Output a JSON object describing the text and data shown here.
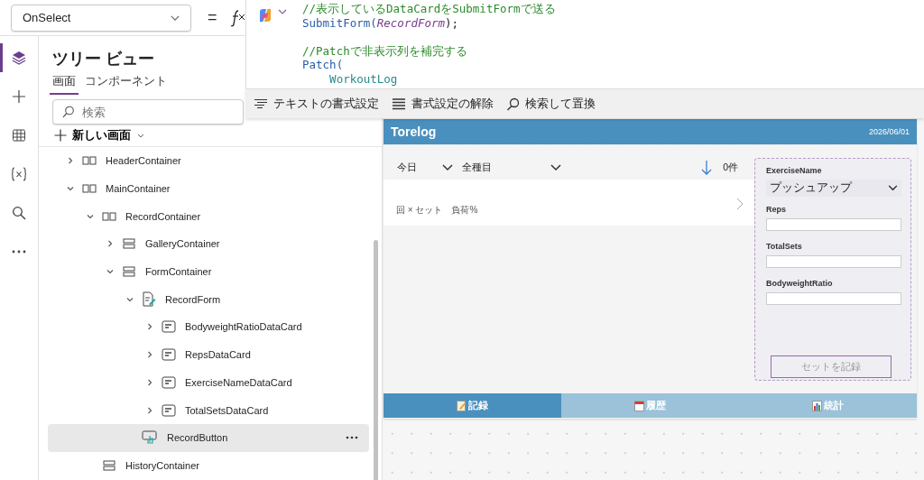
{
  "property_selector": {
    "value": "OnSelect"
  },
  "formula_bar": {
    "equals": "=",
    "lines": [
      [
        {
          "kind": "comment",
          "text": "//表示しているDataCardをSubmitFormで送る"
        }
      ],
      [
        {
          "kind": "function",
          "text": "SubmitForm("
        },
        {
          "kind": "param",
          "text": "RecordForm"
        },
        {
          "kind": "punct",
          "text": ");"
        }
      ],
      [
        {
          "kind": "comment",
          "text": "//Patchで非表示列を補完する"
        }
      ],
      [
        {
          "kind": "function",
          "text": "Patch("
        }
      ],
      [
        {
          "kind": "ident",
          "text": "    WorkoutLog"
        }
      ]
    ]
  },
  "format_toolbar": [
    {
      "kind": "format",
      "label": "テキストの書式設定"
    },
    {
      "kind": "clear",
      "label": "書式設定の解除"
    },
    {
      "kind": "search",
      "label": "検索して置換"
    }
  ],
  "rail": [
    {
      "kind": "layers",
      "selected": true
    },
    {
      "kind": "add",
      "selected": false
    },
    {
      "kind": "data",
      "selected": false
    },
    {
      "kind": "variables",
      "selected": false
    },
    {
      "kind": "search",
      "selected": false
    },
    {
      "kind": "more",
      "selected": false
    }
  ],
  "tree_view": {
    "title": "ツリー ビュー",
    "tabs": [
      {
        "label": "画面",
        "selected": true
      },
      {
        "label": "コンポーネント",
        "selected": false
      }
    ],
    "search": {
      "placeholder": "検索"
    },
    "new_screen": "新しい画面",
    "items": [
      {
        "name": "HeaderContainer",
        "kind": "horizontal",
        "expanded": false,
        "selected": false
      },
      {
        "name": "MainContainer",
        "kind": "horizontal",
        "expanded": true,
        "selected": false,
        "children": [
          {
            "name": "RecordContainer",
            "kind": "horizontal",
            "expanded": true,
            "selected": false,
            "children": [
              {
                "name": "GalleryContainer",
                "kind": "vertical",
                "expanded": false,
                "selected": false
              },
              {
                "name": "FormContainer",
                "kind": "vertical",
                "expanded": true,
                "selected": false,
                "children": [
                  {
                    "name": "RecordForm",
                    "kind": "form",
                    "expanded": true,
                    "selected": false,
                    "children": [
                      {
                        "name": "BodyweightRatioDataCard",
                        "kind": "card",
                        "expanded": false,
                        "selected": false
                      },
                      {
                        "name": "RepsDataCard",
                        "kind": "card",
                        "expanded": false,
                        "selected": false
                      },
                      {
                        "name": "ExerciseNameDataCard",
                        "kind": "card",
                        "expanded": false,
                        "selected": false
                      },
                      {
                        "name": "TotalSetsDataCard",
                        "kind": "card",
                        "expanded": false,
                        "selected": false
                      }
                    ]
                  },
                  {
                    "name": "RecordButton",
                    "kind": "button",
                    "selected": true
                  }
                ]
              }
            ]
          },
          {
            "name": "HistoryContainer",
            "kind": "vertical",
            "selected": false
          }
        ]
      }
    ]
  },
  "app_preview": {
    "title": "Torelog",
    "date": "2026/06/01",
    "filters": [
      {
        "value": "今日"
      },
      {
        "value": "全種目"
      }
    ],
    "count": "0件",
    "gallery_item": {
      "detail": "回 × セット　負荷%"
    },
    "form": {
      "fields": [
        {
          "label": "ExerciseName",
          "kind": "dropdown",
          "value": "プッシュアップ"
        },
        {
          "label": "Reps",
          "kind": "text"
        },
        {
          "label": "TotalSets",
          "kind": "text"
        },
        {
          "label": "BodyweightRatio",
          "kind": "text"
        }
      ],
      "submit": "セットを記録"
    },
    "nav_tabs": [
      {
        "label": "記録",
        "selected": true
      },
      {
        "label": "履歴",
        "selected": false
      },
      {
        "label": "統計",
        "selected": false
      }
    ]
  }
}
